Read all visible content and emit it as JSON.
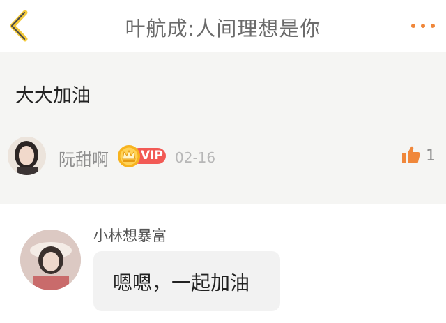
{
  "header": {
    "title": "叶航成:人间理想是你",
    "accent_color": "#f0873a",
    "back_icon": "chevron-left-icon",
    "more_icon": "more-dots-icon"
  },
  "post": {
    "text": "大大加油",
    "author": {
      "name": "阮甜啊",
      "badge": "VIP"
    },
    "date": "02-16",
    "likes": "1",
    "like_icon": "thumbs-up-icon"
  },
  "reply": {
    "author": "小林想暴富",
    "text": "嗯嗯，一起加油"
  }
}
